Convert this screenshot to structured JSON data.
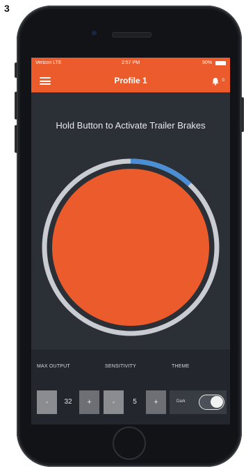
{
  "step_number": "3",
  "status_bar": {
    "carrier": "Verizon  LTE",
    "time": "2:57 PM",
    "battery": "90%"
  },
  "nav": {
    "title": "Profile 1",
    "notification_count": "0"
  },
  "instruction": "Hold Button to Activate Trailer Brakes",
  "brake_button": {
    "output_level": 0.12,
    "colors": {
      "button": "#ec5b2b",
      "ring_track": "#c9cdd2",
      "ring_progress": "#4a8fd6"
    }
  },
  "controls": {
    "max_output": {
      "label": "MAX OUTPUT",
      "value": "32",
      "minus": "-",
      "plus": "+"
    },
    "sensitivity": {
      "label": "SENSITIVITY",
      "value": "5",
      "minus": "-",
      "plus": "+"
    },
    "theme": {
      "label": "THEME",
      "current": "Dark",
      "toggle_on": true
    }
  },
  "colors": {
    "accent": "#ec5b2b",
    "background": "#2b2f36"
  }
}
